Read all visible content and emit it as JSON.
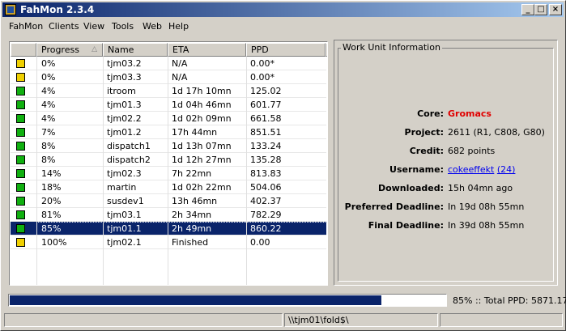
{
  "window": {
    "title": "FahMon 2.3.4"
  },
  "titlebar_buttons": {
    "minimize": "_",
    "maximize": "□",
    "close": "×"
  },
  "menu": [
    "FahMon",
    "Clients",
    "View",
    "Tools",
    "Web",
    "Help"
  ],
  "columns": [
    "Progress",
    "Name",
    "ETA",
    "PPD"
  ],
  "colors": {
    "yellow": "#f0d000",
    "green": "#10b010",
    "selected_bg": "#0a246a",
    "core": "#e00000"
  },
  "rows": [
    {
      "status": "yellow",
      "progress": "0%",
      "name": "tjm03.2",
      "eta": "N/A",
      "ppd": "0.00*"
    },
    {
      "status": "yellow",
      "progress": "0%",
      "name": "tjm03.3",
      "eta": "N/A",
      "ppd": "0.00*"
    },
    {
      "status": "green",
      "progress": "4%",
      "name": "itroom",
      "eta": "1d 17h 10mn",
      "ppd": "125.02"
    },
    {
      "status": "green",
      "progress": "4%",
      "name": "tjm01.3",
      "eta": "1d 04h 46mn",
      "ppd": "601.77"
    },
    {
      "status": "green",
      "progress": "4%",
      "name": "tjm02.2",
      "eta": "1d 02h 09mn",
      "ppd": "661.58"
    },
    {
      "status": "green",
      "progress": "7%",
      "name": "tjm01.2",
      "eta": "17h 44mn",
      "ppd": "851.51"
    },
    {
      "status": "green",
      "progress": "8%",
      "name": "dispatch1",
      "eta": "1d 13h 07mn",
      "ppd": "133.24"
    },
    {
      "status": "green",
      "progress": "8%",
      "name": "dispatch2",
      "eta": "1d 12h 27mn",
      "ppd": "135.28"
    },
    {
      "status": "green",
      "progress": "14%",
      "name": "tjm02.3",
      "eta": "7h 22mn",
      "ppd": "813.83"
    },
    {
      "status": "green",
      "progress": "18%",
      "name": "martin",
      "eta": "1d 02h 22mn",
      "ppd": "504.06"
    },
    {
      "status": "green",
      "progress": "20%",
      "name": "susdev1",
      "eta": "13h 46mn",
      "ppd": "402.37"
    },
    {
      "status": "green",
      "progress": "81%",
      "name": "tjm03.1",
      "eta": "2h 34mn",
      "ppd": "782.29"
    },
    {
      "status": "green",
      "progress": "85%",
      "name": "tjm01.1",
      "eta": "2h 49mn",
      "ppd": "860.22",
      "selected": true
    },
    {
      "status": "yellow",
      "progress": "100%",
      "name": "tjm02.1",
      "eta": "Finished",
      "ppd": "0.00"
    }
  ],
  "info": {
    "title": "Work Unit Information",
    "fields": [
      {
        "label": "Core:",
        "value": "Gromacs",
        "style": "core"
      },
      {
        "label": "Project:",
        "value": "2611 (R1, C808, G80)"
      },
      {
        "label": "Credit:",
        "value": "682 points"
      },
      {
        "label": "Username:",
        "value": "cokeeffekt",
        "extra": "(24)",
        "style": "link"
      },
      {
        "label": "Downloaded:",
        "value": "15h 04mn ago"
      },
      {
        "label": "Preferred Deadline:",
        "value": "In 19d 08h 55mn"
      },
      {
        "label": "Final Deadline:",
        "value": "In 39d 08h 55mn"
      }
    ]
  },
  "progress": {
    "value": 0.85,
    "text": "85% :: Total PPD: 5871.17"
  },
  "statusbar": {
    "left": "",
    "path": "\\\\tjm01\\fold$\\",
    "right": ""
  }
}
